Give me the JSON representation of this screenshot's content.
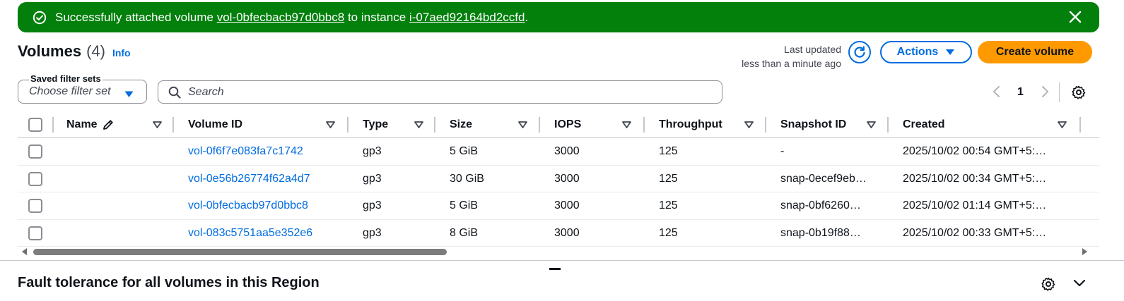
{
  "flash": {
    "prefix": "Successfully attached volume",
    "volume_link": "vol-0bfecbacb97d0bbc8",
    "middle": "to instance",
    "instance_link": "i-07aed92164bd2ccfd",
    "suffix": ".",
    "icon": "success-circle-check-icon",
    "close_icon": "close-icon",
    "color": "#037f0c"
  },
  "header": {
    "title": "Volumes",
    "count": "(4)",
    "info_link": "Info",
    "last_updated_label": "Last updated",
    "last_updated_value": "less than a minute ago",
    "actions_label": "Actions",
    "create_label": "Create volume"
  },
  "filters": {
    "saved_filter_label": "Saved filter sets",
    "saved_filter_placeholder": "Choose filter set",
    "search_placeholder": "Search"
  },
  "pagination": {
    "current_page": "1"
  },
  "table": {
    "columns": [
      "Name",
      "Volume ID",
      "Type",
      "Size",
      "IOPS",
      "Throughput",
      "Snapshot ID",
      "Created"
    ],
    "rows": [
      {
        "name": "",
        "volume_id": "vol-0f6f7e083fa7c1742",
        "type": "gp3",
        "size": "5 GiB",
        "iops": "3000",
        "throughput": "125",
        "snapshot_id": "-",
        "created": "2025/10/02 00:54 GMT+5:…"
      },
      {
        "name": "",
        "volume_id": "vol-0e56b26774f62a4d7",
        "type": "gp3",
        "size": "30 GiB",
        "iops": "3000",
        "throughput": "125",
        "snapshot_id": "snap-0ecef9eb…",
        "created": "2025/10/02 00:34 GMT+5:…"
      },
      {
        "name": "",
        "volume_id": "vol-0bfecbacb97d0bbc8",
        "type": "gp3",
        "size": "5 GiB",
        "iops": "3000",
        "throughput": "125",
        "snapshot_id": "snap-0bf6260…",
        "created": "2025/10/02 01:14 GMT+5:…"
      },
      {
        "name": "",
        "volume_id": "vol-083c5751aa5e352e6",
        "type": "gp3",
        "size": "8 GiB",
        "iops": "3000",
        "throughput": "125",
        "snapshot_id": "snap-0b19f88…",
        "created": "2025/10/02 00:33 GMT+5:…"
      }
    ]
  },
  "fault_tolerance": {
    "title": "Fault tolerance for all volumes in this Region"
  },
  "colors": {
    "link": "#006ce0",
    "primary_button": "#ff9900",
    "success": "#037f0c"
  }
}
